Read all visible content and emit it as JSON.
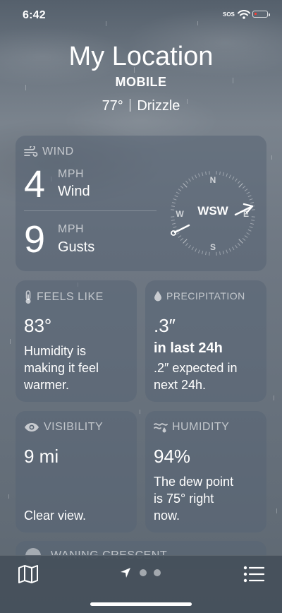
{
  "status": {
    "time": "6:42",
    "sos": "SOS"
  },
  "header": {
    "location": "My Location",
    "sublocation": "MOBILE",
    "temperature": "77°",
    "condition": "Drizzle"
  },
  "wind": {
    "title": "WIND",
    "speed": "4",
    "speed_unit": "MPH",
    "speed_label": "Wind",
    "gusts": "9",
    "gusts_unit": "MPH",
    "gusts_label": "Gusts",
    "direction": "WSW",
    "compass": {
      "n": "N",
      "e": "E",
      "s": "S",
      "w": "W"
    }
  },
  "feels_like": {
    "title": "FEELS LIKE",
    "value": "83°",
    "desc_lines": [
      "Humidity is",
      "making it feel",
      "warmer."
    ]
  },
  "precipitation": {
    "title": "PRECIPITATION",
    "value": ".3″",
    "period": "in last 24h",
    "desc_lines": [
      ".2″ expected in",
      "next 24h."
    ]
  },
  "visibility": {
    "title": "VISIBILITY",
    "value": "9 mi",
    "desc": "Clear view."
  },
  "humidity": {
    "title": "HUMIDITY",
    "value": "94%",
    "desc_lines": [
      "The dew point",
      "is 75° right",
      "now."
    ]
  },
  "moon": {
    "title": "WANING CRESCENT"
  },
  "icons": {
    "wind": "wind-icon",
    "feels_like": "thermometer-icon",
    "precipitation": "drop-icon",
    "visibility": "eye-icon",
    "humidity": "humidity-icon",
    "map": "map-icon",
    "location": "location-arrow-icon",
    "list": "list-icon"
  },
  "colors": {
    "battery": "#ff3b30",
    "card": "#586474"
  }
}
